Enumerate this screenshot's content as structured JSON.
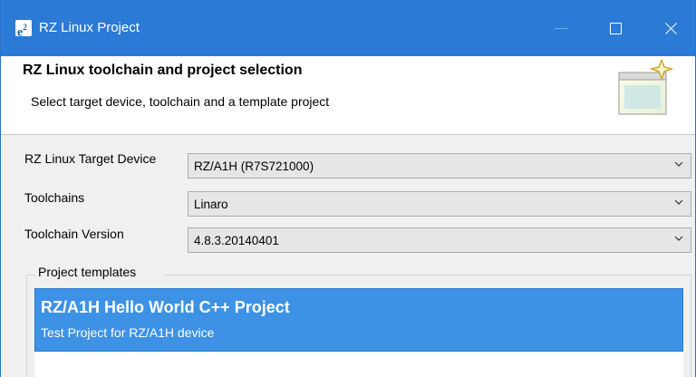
{
  "window": {
    "logo_text": "e²",
    "title": "RZ Linux Project"
  },
  "header": {
    "title": "RZ Linux toolchain and project selection",
    "description": "Select target device, toolchain and a template project"
  },
  "form": {
    "target_device": {
      "label": "RZ Linux Target Device",
      "value": "RZ/A1H (R7S721000)"
    },
    "toolchains": {
      "label": "Toolchains",
      "value": "Linaro"
    },
    "toolchain_version": {
      "label": "Toolchain Version",
      "value": "4.8.3.20140401"
    }
  },
  "templates": {
    "group_label": "Project templates",
    "items": [
      {
        "title": "RZ/A1H Hello World C++ Project",
        "description": "Test Project for RZ/A1H device",
        "selected": true
      }
    ]
  },
  "colors": {
    "titlebar": "#2b7ad6",
    "selection": "#3d92e6"
  }
}
